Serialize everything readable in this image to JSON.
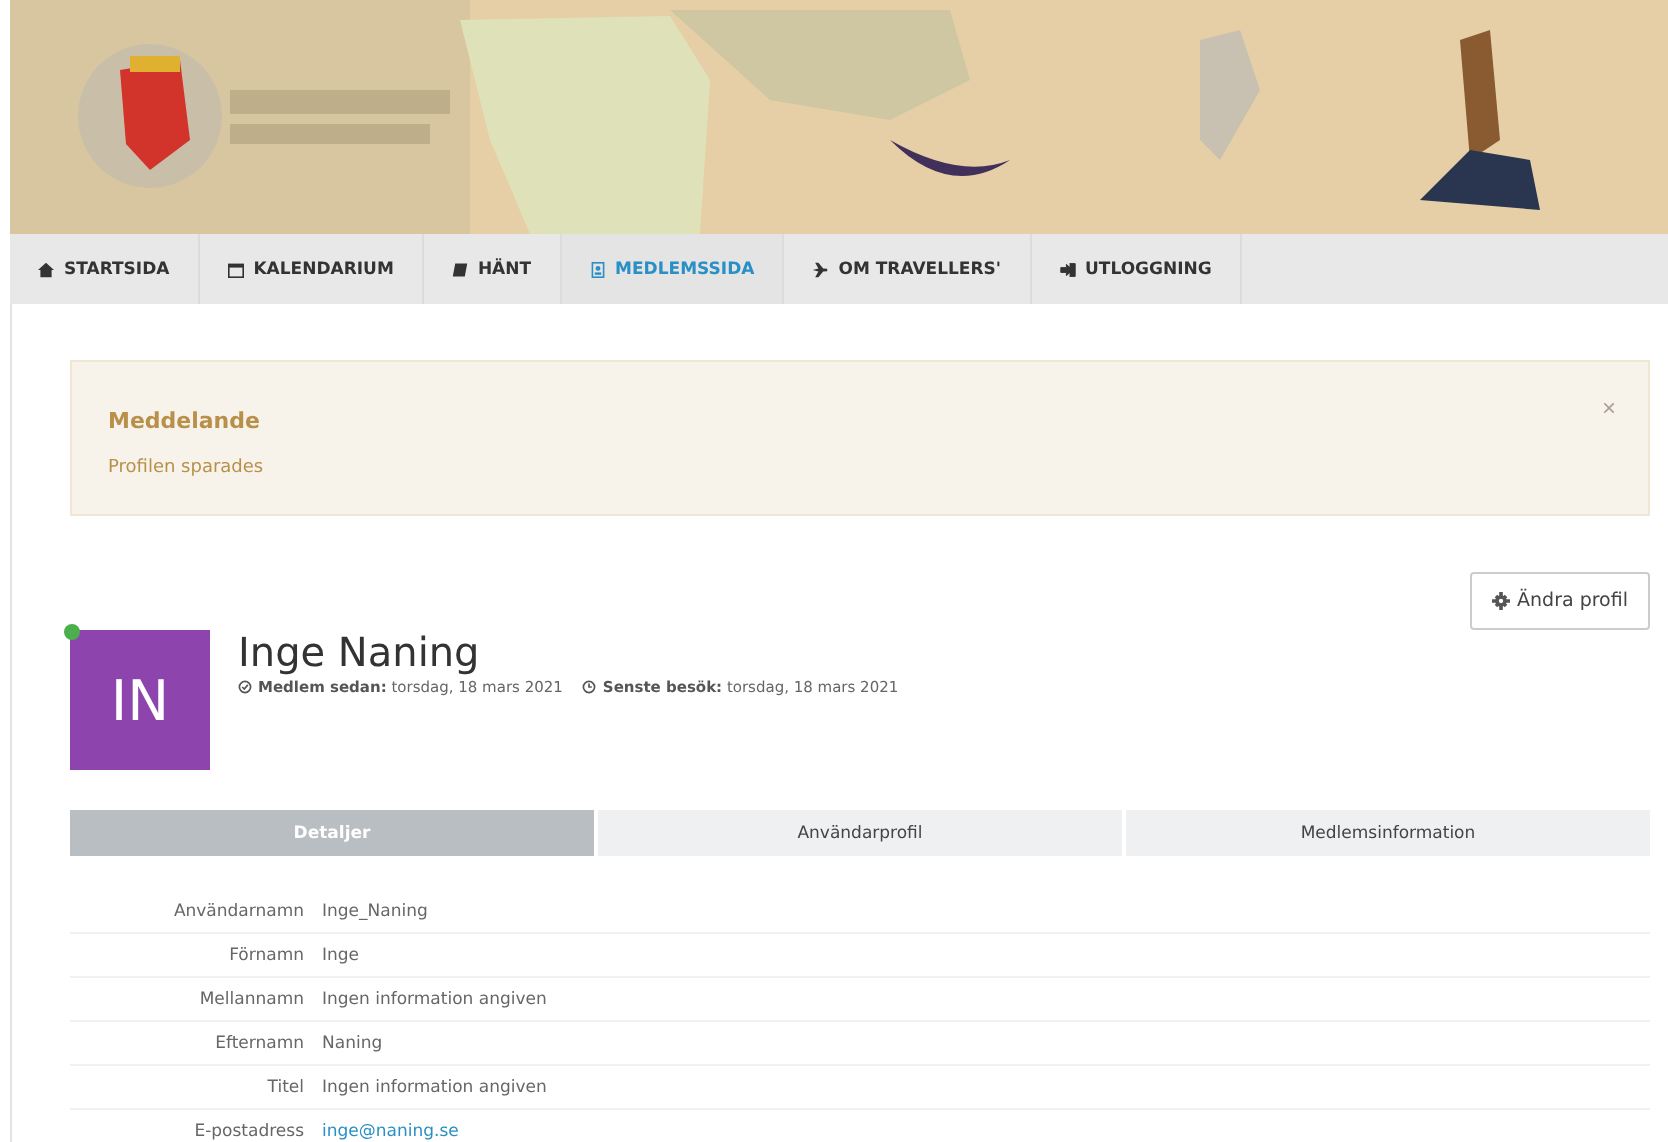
{
  "nav": [
    {
      "label": "STARTSIDA",
      "kind": "home",
      "selected": false
    },
    {
      "label": "KALENDARIUM",
      "kind": "calendar",
      "selected": false
    },
    {
      "label": "HÄNT",
      "kind": "book",
      "selected": false
    },
    {
      "label": "MEDLEMSSIDA",
      "kind": "badge",
      "selected": true
    },
    {
      "label": "OM TRAVELLERS'",
      "kind": "plane",
      "selected": false
    },
    {
      "label": "UTLOGGNING",
      "kind": "signout",
      "selected": false
    }
  ],
  "alert": {
    "title": "Meddelande",
    "message": "Profilen sparades",
    "close": "×"
  },
  "edit_button": {
    "label": "Ändra profil"
  },
  "profile": {
    "initials": "IN",
    "online": true,
    "name": "Inge Naning",
    "meta": [
      {
        "kind": "check",
        "label": "Medlem sedan:",
        "value": "torsdag, 18 mars 2021"
      },
      {
        "kind": "clock",
        "label": "Senste besök:",
        "value": "torsdag, 18 mars 2021"
      }
    ]
  },
  "tabs": [
    {
      "label": "Detaljer",
      "selected": true
    },
    {
      "label": "Användarprofil",
      "selected": false
    },
    {
      "label": "Medlemsinformation",
      "selected": false
    }
  ],
  "details": [
    {
      "label": "Användarnamn",
      "value": "Inge_Naning",
      "kind": "text"
    },
    {
      "label": "Förnamn",
      "value": "Inge",
      "kind": "text"
    },
    {
      "label": "Mellannamn",
      "value": "Ingen information angiven",
      "kind": "text"
    },
    {
      "label": "Efternamn",
      "value": "Naning",
      "kind": "text"
    },
    {
      "label": "Titel",
      "value": "Ingen information angiven",
      "kind": "text"
    },
    {
      "label": "E-postadress",
      "value": "inge@naning.se",
      "kind": "link"
    }
  ]
}
